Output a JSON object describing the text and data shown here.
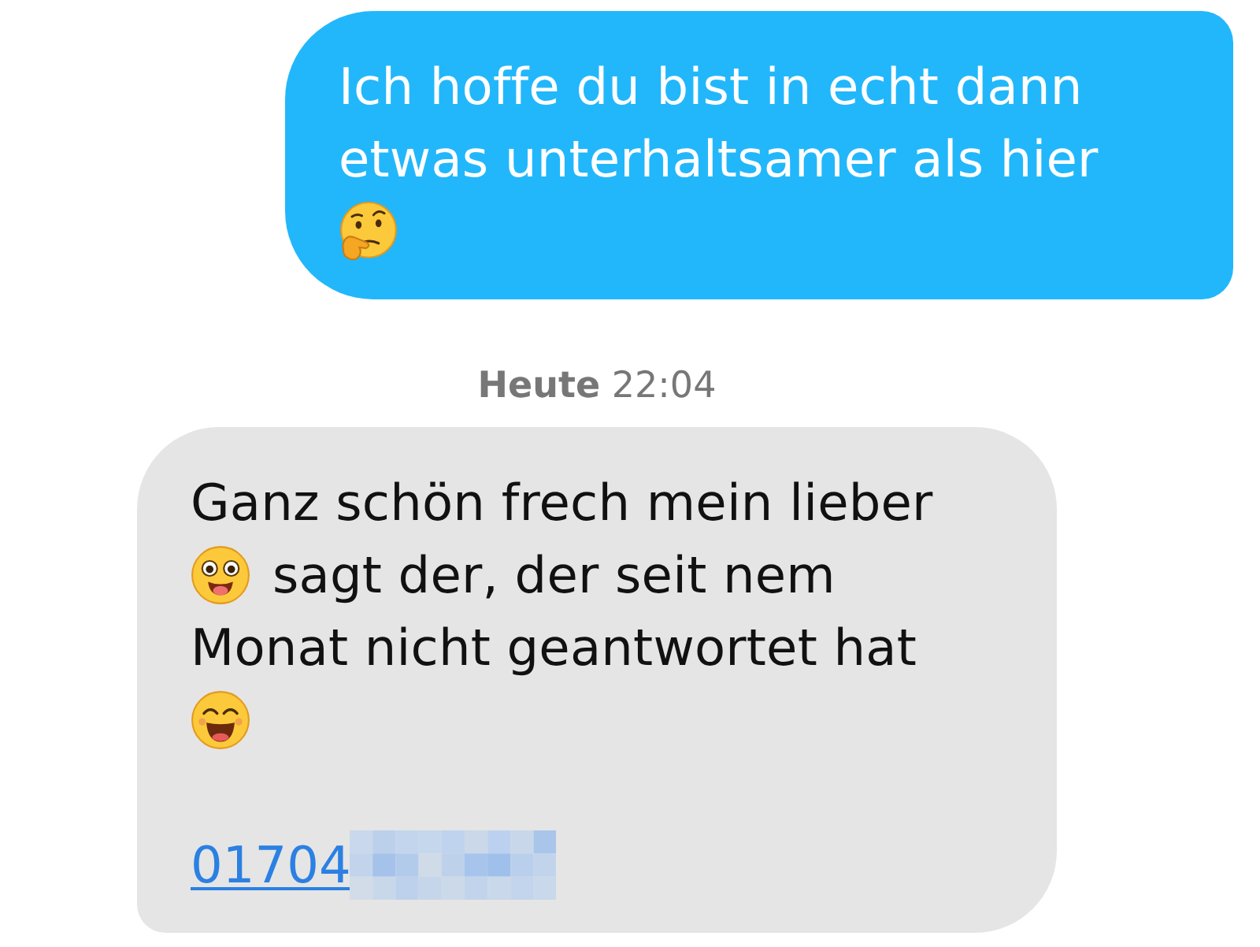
{
  "messages": [
    {
      "kind": "sent",
      "rows": [
        [
          {
            "kind": "text",
            "text": "Ich hoffe du bist in echt dann etwas unterhaltsamer als hier"
          }
        ],
        [
          {
            "kind": "emoji"
          }
        ]
      ]
    },
    {
      "kind": "timestamp",
      "text": "**Heute** 22:04"
    },
    {
      "kind": "received",
      "rows": [
        [
          {
            "kind": "text",
            "text": "Ganz schön frech mein lieber"
          }
        ],
        [
          {
            "kind": "emoji"
          },
          {
            "kind": "text",
            "text": "sagt der, der seit nem"
          }
        ],
        [
          {
            "kind": "text",
            "text": "Monat nicht geantwortet hat"
          }
        ],
        [
          {
            "kind": "emoji"
          }
        ],
        [
          {
            "kind": "link",
            "text": "01704",
            "redacted": true
          }
        ]
      ]
    }
  ]
}
